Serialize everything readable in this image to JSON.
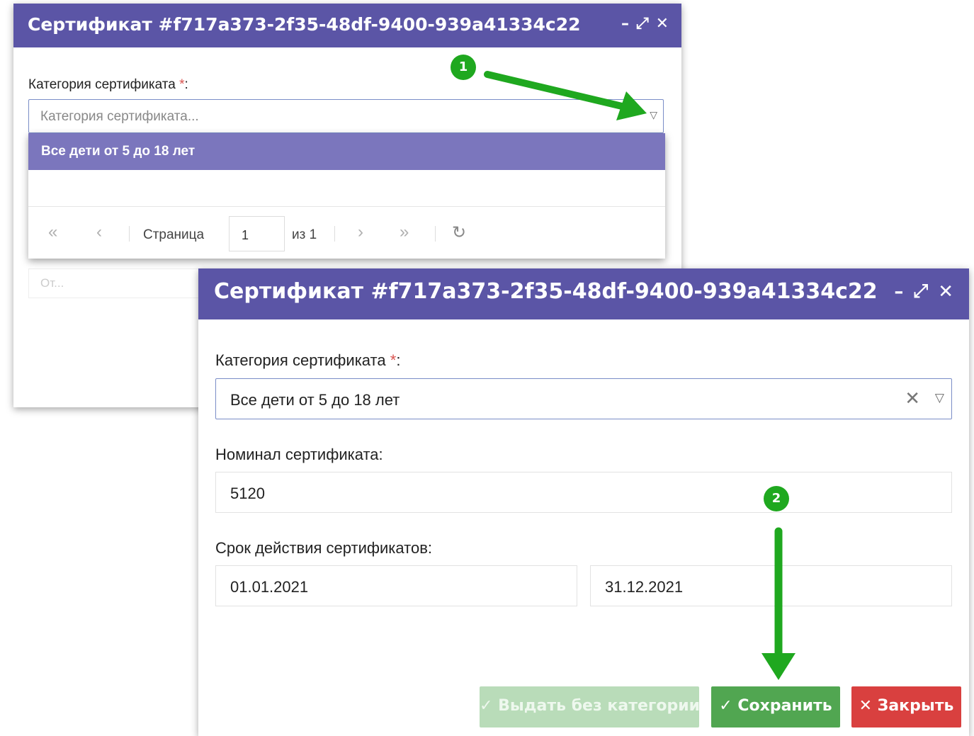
{
  "dialog_back": {
    "title": "Сертификат #f717a373-2f35-48df-9400-939a41334c22",
    "controls": {
      "minimize": "–",
      "maximize": "⤢",
      "close": "✕"
    },
    "category_label": "Категория сертификата",
    "required_mark": "*",
    "label_suffix": ":",
    "category_placeholder": "Категория сертификата...",
    "ghost_input_placeholder": "От...",
    "dropdown": {
      "option": "Все дети от 5 до 18 лет",
      "pager": {
        "first": "«",
        "prev": "‹",
        "page_label": "Страница",
        "page_value": "1",
        "of_label": "из 1",
        "next": "›",
        "last": "»",
        "refresh": "↻"
      }
    }
  },
  "dialog_front": {
    "title": "Сертификат #f717a373-2f35-48df-9400-939a41334c22",
    "controls": {
      "minimize": "–",
      "maximize": "⤢",
      "close": "✕"
    },
    "category_label": "Категория сертификата",
    "required_mark": "*",
    "label_suffix": ":",
    "category_value": "Все дети от 5 до 18 лет",
    "nominal_label": "Номинал сертификата:",
    "nominal_value": "5120",
    "period_label": "Срок действия сертификатов:",
    "date_from": "01.01.2021",
    "date_to": "31.12.2021",
    "buttons": {
      "issue_without_category": "✓ Выдать без категории",
      "save": "✓ Сохранить",
      "close": "✕ Закрыть"
    }
  },
  "annotations": {
    "step1": "1",
    "step2": "2",
    "color": "#1fa81f"
  },
  "colors": {
    "titlebar": "#5b55a6",
    "option_selected": "#7b76bd",
    "save": "#51a651",
    "close": "#d9403f"
  }
}
